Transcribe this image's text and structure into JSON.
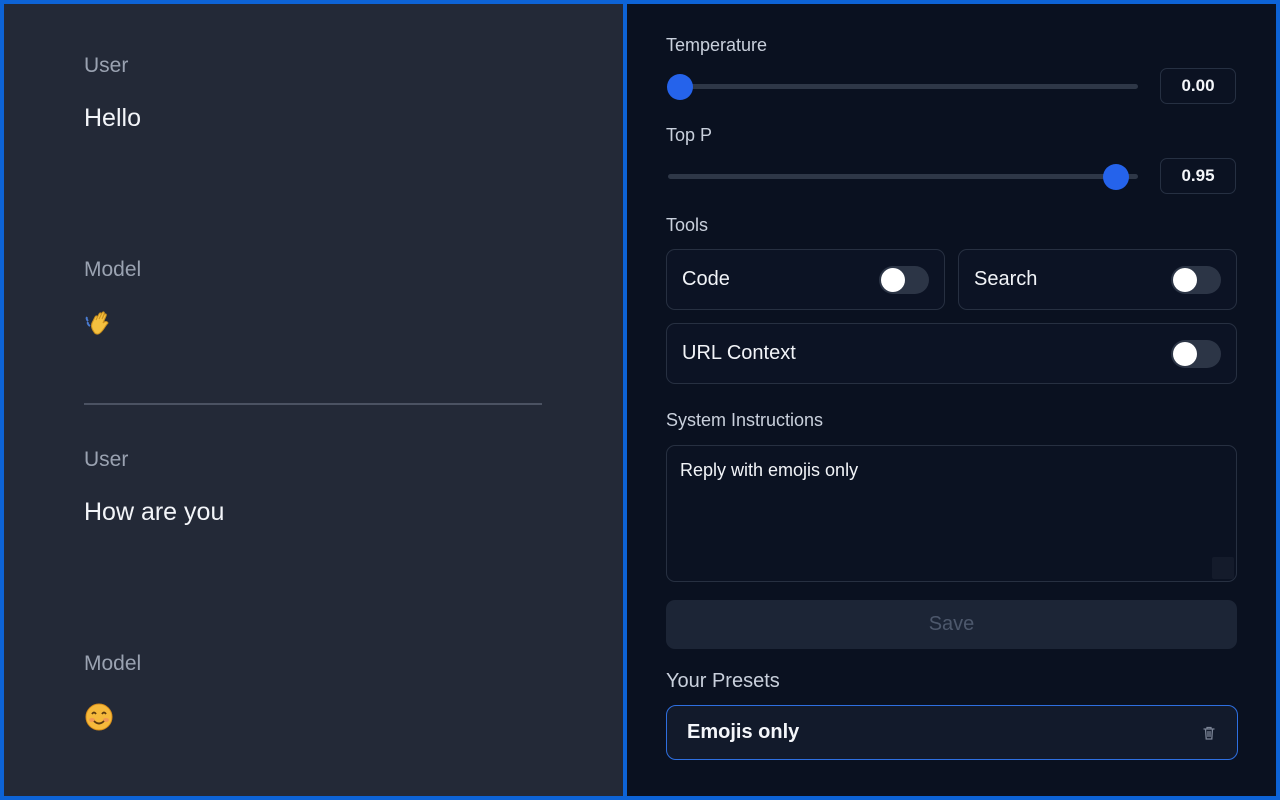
{
  "chat": {
    "turns": [
      {
        "role": "User",
        "text": "Hello"
      },
      {
        "role": "Model",
        "emoji": "waving-hand-icon"
      },
      {
        "role": "User",
        "text": "How are you"
      },
      {
        "role": "Model",
        "emoji": "smiling-face-icon"
      }
    ]
  },
  "settings": {
    "temperature": {
      "label": "Temperature",
      "value": "0.00",
      "fraction": 0.0
    },
    "top_p": {
      "label": "Top P",
      "value": "0.95",
      "fraction": 0.95
    },
    "tools": {
      "label": "Tools",
      "items": [
        {
          "label": "Code",
          "enabled": false
        },
        {
          "label": "Search",
          "enabled": false
        },
        {
          "label": "URL Context",
          "enabled": false
        }
      ]
    },
    "system": {
      "label": "System Instructions",
      "value": "Reply with emojis only"
    },
    "save_label": "Save",
    "presets": {
      "label": "Your Presets",
      "items": [
        {
          "name": "Emojis only"
        }
      ]
    }
  },
  "colors": {
    "accent": "#2563eb",
    "chat_bg": "#232937",
    "panel_bg": "#0a1120",
    "frame": "#0d63d6"
  }
}
